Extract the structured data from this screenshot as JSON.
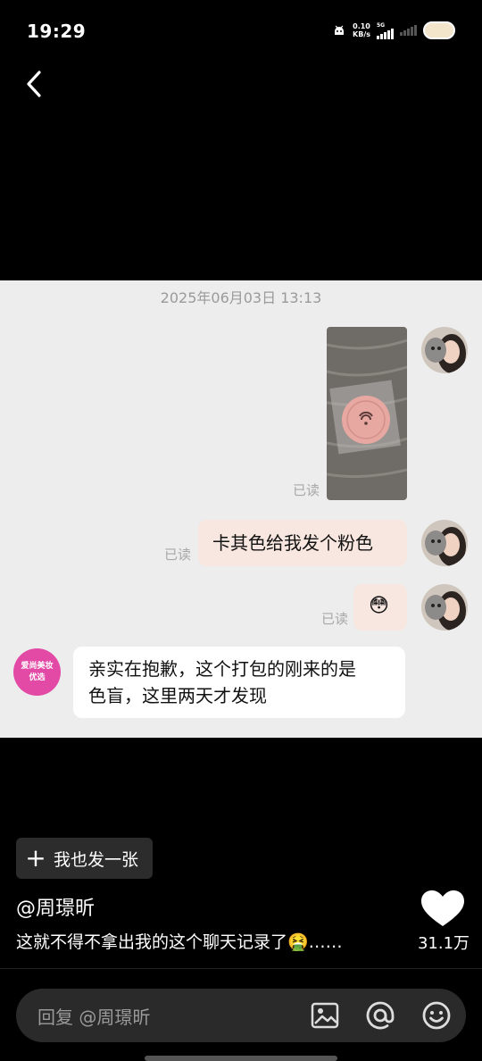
{
  "status_bar": {
    "time": "19:29",
    "net_speed_value": "0.10",
    "net_speed_unit": "KB/s",
    "network_type": "5G"
  },
  "chat": {
    "timestamp": "2025年06月03日 13:13",
    "read_label": "已读",
    "messages": [
      {
        "side": "self",
        "type": "image"
      },
      {
        "side": "self",
        "type": "text",
        "text": "卡其色给我发个粉色"
      },
      {
        "side": "self",
        "type": "emoji",
        "text": "😳"
      },
      {
        "side": "other",
        "type": "text",
        "line1": "亲实在抱歉，这个打包的刚来的是",
        "line2": "色盲，这里两天才发现"
      }
    ],
    "shop_avatar_line1": "爱尚美妆",
    "shop_avatar_line2": "优选"
  },
  "post": {
    "post_button_label": "我也发一张",
    "author": "@周璟昕",
    "caption": "这就不得不拿出我的这个聊天记录了🤮……",
    "like_count": "31.1万"
  },
  "reply": {
    "placeholder": "回复 @周璟昕"
  },
  "colors": {
    "shop_avatar": "#e24aa6",
    "self_bubble": "#f8e6e0",
    "chat_bg": "#ededed"
  }
}
